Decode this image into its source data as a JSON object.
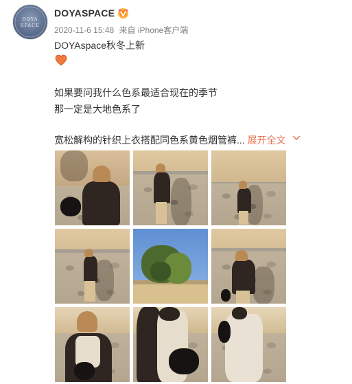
{
  "user": {
    "name": "DOYASPACE",
    "avatar_text": "DOYA SPACE"
  },
  "meta": {
    "datetime": "2020-11-6 15:48",
    "source": "来自 iPhone客户端"
  },
  "post": {
    "line1": "DOYAspace秋冬上新",
    "line2": "如果要问我什么色系最适合现在的季节",
    "line3": "那一定是大地色系了",
    "line4": "宽松解构的针织上衣搭配同色系黄色烟管裤...",
    "expand_label": "展开全文"
  },
  "colors": {
    "accent": "#eb7350",
    "heart": "#f07b3f",
    "meta": "#808080"
  },
  "icons": [
    "vip-badge-icon",
    "heart-icon",
    "chevron-down-icon"
  ],
  "photos": [
    "photo-1",
    "photo-2",
    "photo-3",
    "photo-4",
    "photo-5",
    "photo-6",
    "photo-7",
    "photo-8",
    "photo-9"
  ]
}
